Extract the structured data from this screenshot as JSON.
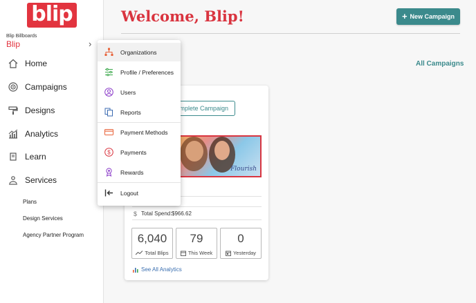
{
  "brand": {
    "logo_text": "blip",
    "account_label": "Blip Billboards",
    "account_name": "Blip"
  },
  "sidebar": {
    "items": [
      {
        "label": "Home",
        "icon": "home-icon"
      },
      {
        "label": "Campaigns",
        "icon": "target-icon"
      },
      {
        "label": "Designs",
        "icon": "paint-roller-icon"
      },
      {
        "label": "Analytics",
        "icon": "chart-icon"
      },
      {
        "label": "Learn",
        "icon": "book-icon"
      },
      {
        "label": "Services",
        "icon": "services-icon"
      }
    ],
    "services_sub": [
      "Plans",
      "Design Services",
      "Agency Partner Program"
    ]
  },
  "header": {
    "title": "Welcome, Blip!",
    "new_campaign": "New Campaign"
  },
  "campaigns": {
    "all_link": "All Campaigns"
  },
  "card": {
    "complete_button": "Complete Campaign",
    "banner_brand": "Flourish",
    "spend_label": "Total Spend:",
    "spend_value": "$966.62",
    "stats": [
      {
        "value": "6,040",
        "label": "Total Blips"
      },
      {
        "value": "79",
        "label": "This Week"
      },
      {
        "value": "0",
        "label": "Yesterday"
      }
    ],
    "analytics_link": "See All Analytics"
  },
  "menu": {
    "items": [
      {
        "label": "Organizations",
        "icon": "org-chart-icon",
        "color": "#e8633a"
      },
      {
        "label": "Profile / Preferences",
        "icon": "sliders-icon",
        "color": "#3aa84a"
      },
      {
        "label": "Users",
        "icon": "user-circle-icon",
        "color": "#8a3ac8"
      },
      {
        "label": "Reports",
        "icon": "copy-icon",
        "color": "#3a6ab0"
      },
      {
        "label": "Payment Methods",
        "icon": "credit-card-icon",
        "color": "#e8633a"
      },
      {
        "label": "Payments",
        "icon": "dollar-circle-icon",
        "color": "#d9343f"
      },
      {
        "label": "Rewards",
        "icon": "award-icon",
        "color": "#8a3ac8"
      },
      {
        "label": "Logout",
        "icon": "logout-icon",
        "color": "#333333"
      }
    ]
  },
  "colors": {
    "brand_red": "#e2343f",
    "teal": "#3b8a8c",
    "link_blue": "#3b6fb0"
  }
}
